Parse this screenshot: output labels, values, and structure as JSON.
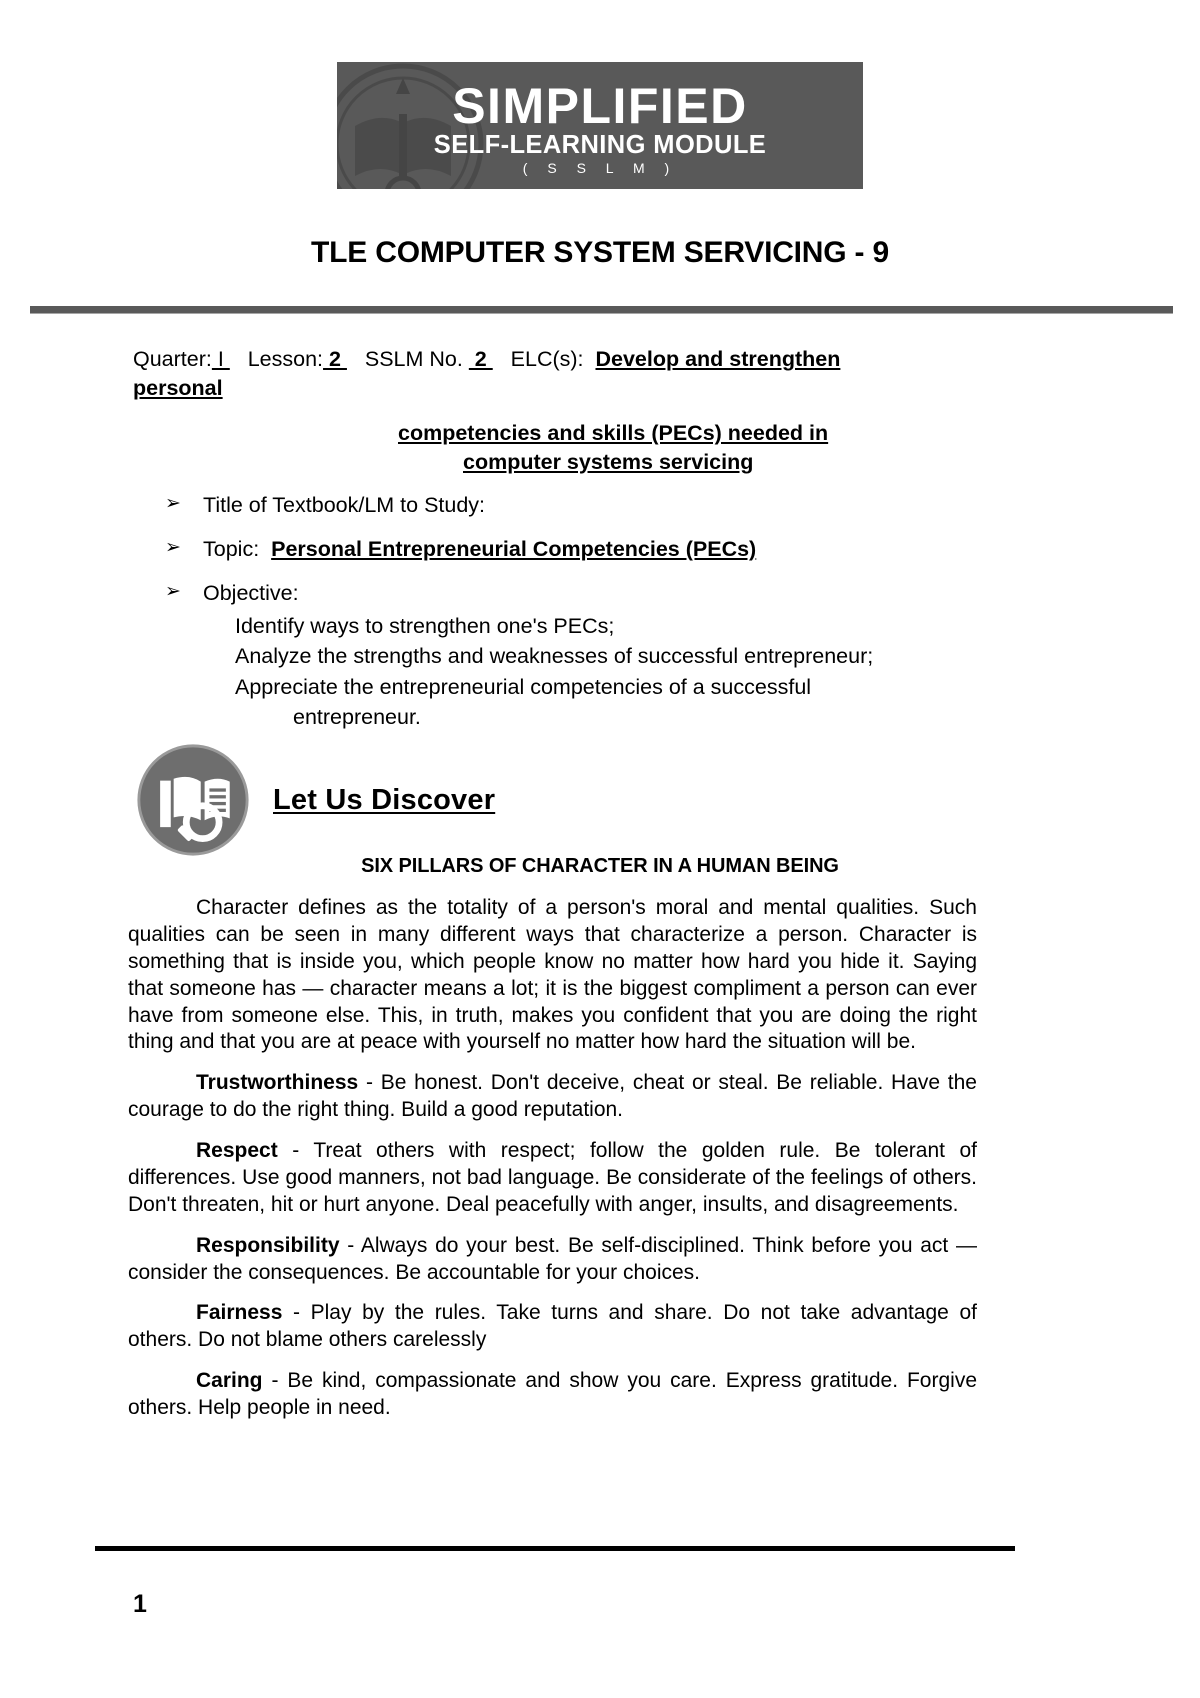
{
  "banner": {
    "title": "SIMPLIFIED",
    "subtitle": "SELF-LEARNING MODULE",
    "acronym": "( S S L M )",
    "background_color": "#595959",
    "text_color": "#ffffff",
    "watermark_icon": "school-seal-watermark"
  },
  "document": {
    "title": "TLE COMPUTER SYSTEM SERVICING - 9",
    "rule_color": "#595959"
  },
  "meta": {
    "quarter_label": "Quarter:",
    "quarter_value": " I ",
    "lesson_label": "Lesson:",
    "lesson_value": " 2 ",
    "sslm_label": "SSLM No.",
    "sslm_value": " 2 ",
    "elc_label": "ELC(s):",
    "elc_value_line1": "Develop and strengthen",
    "elc_value_line2": "personal",
    "elc_value_line3": "competencies and skills (PECs) needed in",
    "elc_value_line4": "computer systems servicing"
  },
  "bullets": [
    {
      "marker": "➢",
      "label": "Title of Textbook/LM to Study:",
      "value": ""
    },
    {
      "marker": "➢",
      "label": "Topic:",
      "value": "Personal Entrepreneurial Competencies (PECs)"
    },
    {
      "marker": "➢",
      "label": "Objective:",
      "value": ""
    }
  ],
  "objectives": [
    "Identify ways to strengthen one's PECs;",
    "Analyze the strengths and weaknesses of successful entrepreneur;",
    "Appreciate the entrepreneurial competencies of a successful",
    "entrepreneur."
  ],
  "section": {
    "icon": "book-magnifier-icon",
    "icon_color": "#6e6e6e",
    "title": "Let Us   Discover"
  },
  "content": {
    "heading": "SIX PILLARS OF CHARACTER IN A HUMAN BEING",
    "intro": "Character defines as the totality of a person's moral and mental qualities. Such qualities can be seen in many different ways that characterize a person. Character is something that is inside you, which people know no matter how hard you hide it. Saying that someone has — character means a lot; it is the biggest compliment a person can ever have from someone else. This, in truth, makes you confident that you are doing the right thing and that you are at peace with yourself no matter how hard the situation will be.",
    "pillars": [
      {
        "name": "Trustworthiness",
        "text": " - Be honest. Don't deceive, cheat or steal. Be reliable. Have the courage to do the right thing. Build a good reputation."
      },
      {
        "name": "Respect",
        "text": " - Treat others with respect; follow the golden rule. Be tolerant of differences. Use good manners, not bad language. Be considerate of the feelings of others.  Don't threaten, hit or hurt anyone. Deal peacefully with anger, insults, and disagreements."
      },
      {
        "name": "Responsibility",
        "text": " - Always do your best. Be self-disciplined. Think before you act — consider the consequences. Be accountable for your choices."
      },
      {
        "name": "Fairness",
        "text": " - Play by the rules.  Take turns and share. Do not take advantage of others. Do not blame others carelessly"
      },
      {
        "name": "Caring",
        "text": " - Be kind, compassionate and show you care. Express gratitude. Forgive others. Help people in need."
      }
    ]
  },
  "footer": {
    "page_number": "1"
  }
}
